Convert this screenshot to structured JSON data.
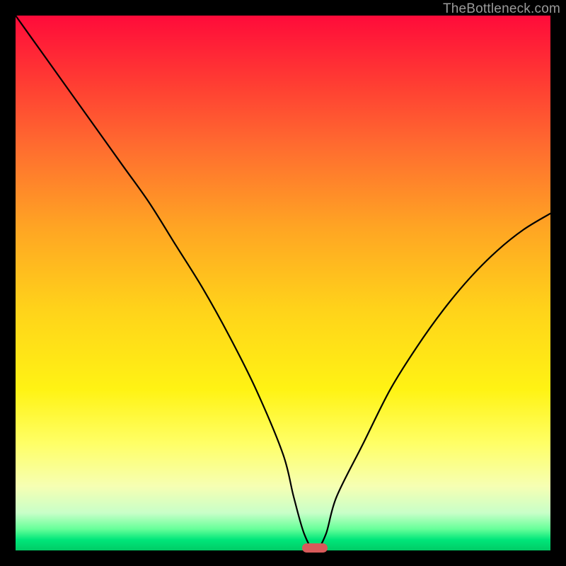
{
  "watermark": {
    "text": "TheBottleneck.com"
  },
  "axes": {
    "xrange": [
      0,
      100
    ],
    "yrange": [
      0,
      100
    ]
  },
  "chart_data": {
    "type": "line",
    "title": "",
    "xlabel": "",
    "ylabel": "",
    "xlim": [
      0,
      100
    ],
    "ylim": [
      0,
      100
    ],
    "series": [
      {
        "name": "bottleneck-curve",
        "x": [
          0,
          5,
          10,
          15,
          20,
          25,
          30,
          35,
          40,
          45,
          50,
          52,
          54,
          56,
          58,
          60,
          65,
          70,
          75,
          80,
          85,
          90,
          95,
          100
        ],
        "values": [
          100,
          93,
          86,
          79,
          72,
          65,
          57,
          49,
          40,
          30,
          18,
          10,
          3,
          0,
          3,
          10,
          20,
          30,
          38,
          45,
          51,
          56,
          60,
          63
        ]
      }
    ],
    "annotations": [
      {
        "name": "sweet-spot-marker",
        "x": 56,
        "y": 0
      }
    ],
    "grid": false
  },
  "colors": {
    "background_top": "#ff0b3a",
    "background_bottom": "#00cc66",
    "curve": "#000000",
    "marker": "#d85a5a",
    "frame": "#000000",
    "watermark": "#9a9a9a"
  }
}
